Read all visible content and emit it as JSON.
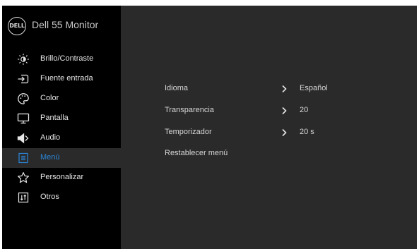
{
  "brand": {
    "logo_text": "DELL",
    "title": "Dell 55 Monitor"
  },
  "colors": {
    "panel_background": "#2a2a2a",
    "sidebar_background": "#000000",
    "text": "#e6e6e6",
    "active_text": "#2b86d6"
  },
  "sidebar": {
    "items": [
      {
        "label": "Brillo/Contraste",
        "icon": "brightness-icon",
        "active": false
      },
      {
        "label": "Fuente entrada",
        "icon": "input-source-icon",
        "active": false
      },
      {
        "label": "Color",
        "icon": "color-palette-icon",
        "active": false
      },
      {
        "label": "Pantalla",
        "icon": "display-icon",
        "active": false
      },
      {
        "label": "Audio",
        "icon": "speaker-icon",
        "active": false
      },
      {
        "label": "Menú",
        "icon": "menu-icon",
        "active": true
      },
      {
        "label": "Personalizar",
        "icon": "star-icon",
        "active": false
      },
      {
        "label": "Otros",
        "icon": "others-icon",
        "active": false
      }
    ]
  },
  "menu_settings": {
    "rows": [
      {
        "label": "Idioma",
        "value": "Español",
        "has_arrow": true
      },
      {
        "label": "Transparencia",
        "value": "20",
        "has_arrow": true
      },
      {
        "label": "Temporizador",
        "value": "20 s",
        "has_arrow": true
      },
      {
        "label": "Restablecer menú",
        "value": "",
        "has_arrow": false
      }
    ]
  }
}
